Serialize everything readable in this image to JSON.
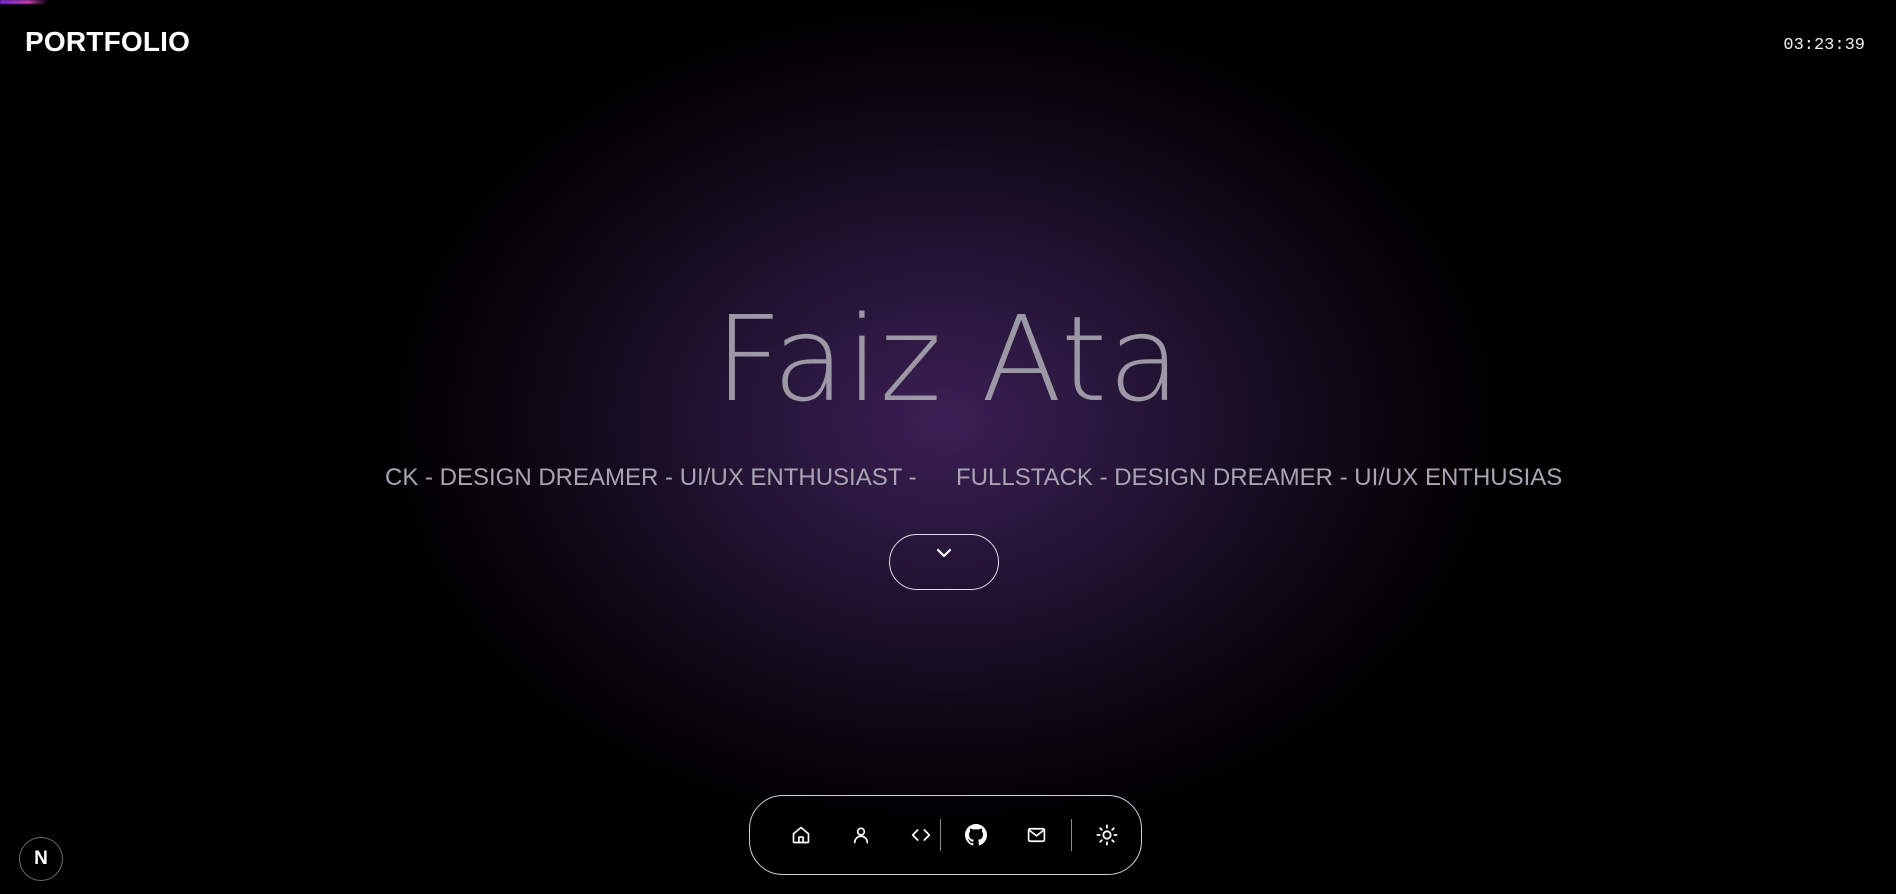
{
  "header": {
    "brand": "PORTFOLIO",
    "clock": "03:23:39"
  },
  "hero": {
    "name": "Faiz Ata",
    "marquee": [
      "CK - DESIGN DREAMER - UI/UX ENTHUSIAST -",
      "FULLSTACK - DESIGN DREAMER - UI/UX ENTHUSIAS"
    ],
    "scroll_icon": "chevron-down-icon"
  },
  "dock": {
    "items": [
      {
        "icon": "home-icon"
      },
      {
        "icon": "user-icon"
      },
      {
        "icon": "code-icon"
      },
      {
        "icon": "github-icon"
      },
      {
        "icon": "mail-icon"
      },
      {
        "icon": "sun-icon"
      }
    ]
  },
  "badge": {
    "label": "N"
  },
  "colors": {
    "background": "#000000",
    "glow": "#3c1f55",
    "name_text": "#9c98a6",
    "marquee_text": "#a9a4b2",
    "border": "#d4d0d9"
  }
}
